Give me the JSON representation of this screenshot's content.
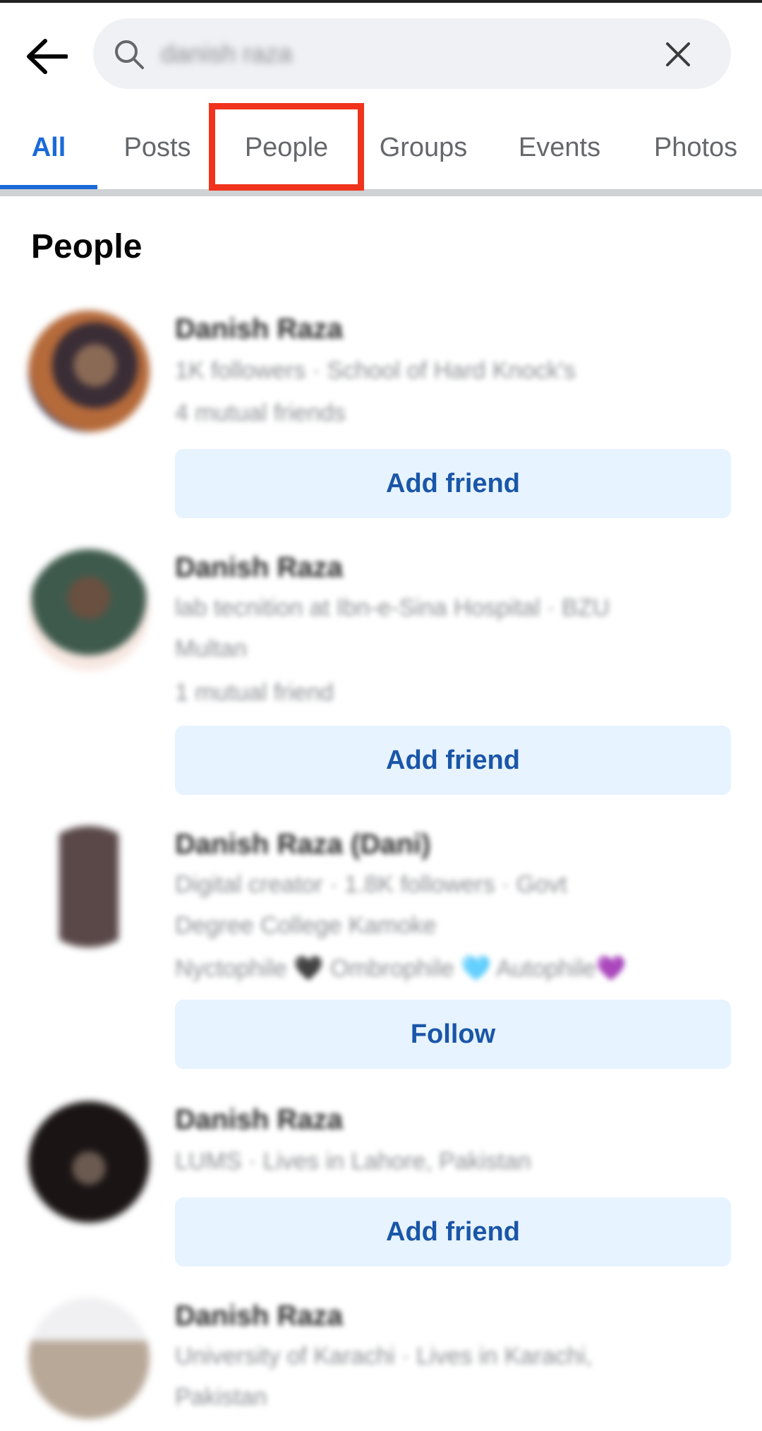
{
  "search": {
    "query": "danish raza"
  },
  "tabs": [
    {
      "label": "All"
    },
    {
      "label": "Posts"
    },
    {
      "label": "People"
    },
    {
      "label": "Groups"
    },
    {
      "label": "Events"
    },
    {
      "label": "Photos"
    }
  ],
  "section": {
    "title": "People"
  },
  "people": [
    {
      "name": "Danish Raza",
      "line1": "1K followers · School of Hard Knock's",
      "line2": "4 mutual friends",
      "action": "Add friend"
    },
    {
      "name": "Danish Raza",
      "line1": "lab tecnition at Ibn-e-Sina Hospital · BZU",
      "line2": "Multan",
      "line3": "1 mutual friend",
      "action": "Add friend"
    },
    {
      "name": "Danish Raza (Dani)",
      "line1": "Digital creator · 1.8K followers · Govt",
      "line2": "Degree College Kamoke",
      "line3": "Nyctophile 🖤 Ombrophile 🩵 Autophile💜",
      "action": "Follow"
    },
    {
      "name": "Danish Raza",
      "line1": "LUMS · Lives in Lahore, Pakistan",
      "action": "Add friend"
    },
    {
      "name": "Danish Raza",
      "line1": "University of Karachi · Lives in Karachi,",
      "line2": "Pakistan"
    }
  ],
  "colors": {
    "accent": "#1b6ad8",
    "button_bg": "#e7f3ff",
    "button_text": "#1a56a8",
    "highlight": "#f0331c"
  },
  "icons": {
    "back": "arrow-left-icon",
    "search": "search-icon",
    "clear": "close-icon"
  }
}
